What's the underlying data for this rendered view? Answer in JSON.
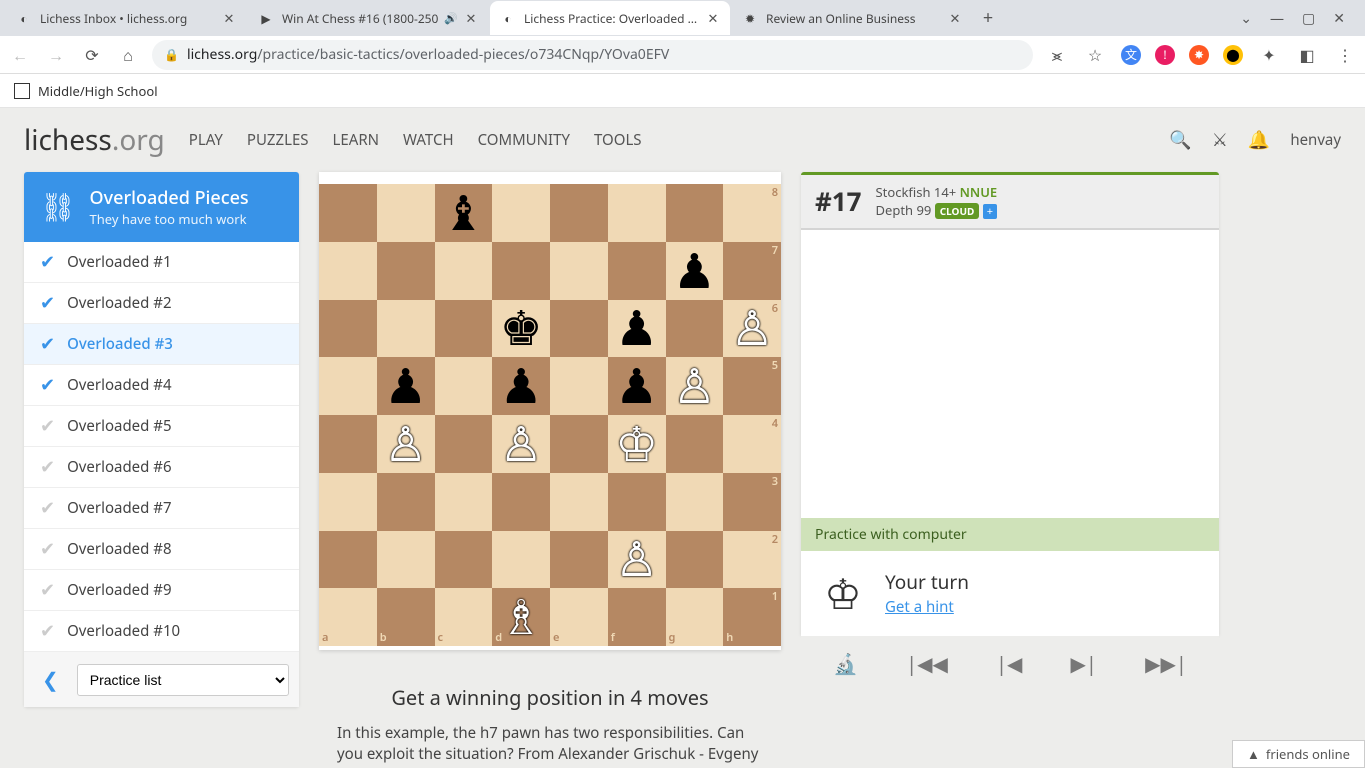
{
  "browser": {
    "tabs": [
      {
        "title": "Lichess Inbox • lichess.org",
        "favicon": "◐"
      },
      {
        "title": "Win At Chess #16 (1800-250",
        "favicon": "▶",
        "audio": true
      },
      {
        "title": "Lichess Practice: Overloaded Pie",
        "favicon": "◐",
        "active": true
      },
      {
        "title": "Review an Online Business",
        "favicon": "✹"
      }
    ],
    "url_host": "lichess.org",
    "url_path": "/practice/basic-tactics/overloaded-pieces/o734CNqp/YOva0EFV",
    "bookmark": "Middle/High School"
  },
  "nav": {
    "links": [
      "PLAY",
      "PUZZLES",
      "LEARN",
      "WATCH",
      "COMMUNITY",
      "TOOLS"
    ],
    "username": "henvay"
  },
  "practice": {
    "title": "Overloaded Pieces",
    "subtitle": "They have too much work",
    "items": [
      {
        "label": "Overloaded #1",
        "status": "done"
      },
      {
        "label": "Overloaded #2",
        "status": "done"
      },
      {
        "label": "Overloaded #3",
        "status": "done",
        "current": true
      },
      {
        "label": "Overloaded #4",
        "status": "done"
      },
      {
        "label": "Overloaded #5",
        "status": "pending"
      },
      {
        "label": "Overloaded #6",
        "status": "pending"
      },
      {
        "label": "Overloaded #7",
        "status": "pending"
      },
      {
        "label": "Overloaded #8",
        "status": "pending"
      },
      {
        "label": "Overloaded #9",
        "status": "pending"
      },
      {
        "label": "Overloaded #10",
        "status": "pending"
      }
    ],
    "selector": "Practice list"
  },
  "board": {
    "pieces": [
      {
        "sq": "c8",
        "glyph": "♝",
        "color": "black"
      },
      {
        "sq": "g7",
        "glyph": "♟",
        "color": "black"
      },
      {
        "sq": "f6",
        "glyph": "♟",
        "color": "black"
      },
      {
        "sq": "h6",
        "glyph": "♙",
        "color": "white"
      },
      {
        "sq": "d6",
        "glyph": "♚",
        "color": "black"
      },
      {
        "sq": "b5",
        "glyph": "♟",
        "color": "black"
      },
      {
        "sq": "d5",
        "glyph": "♟",
        "color": "black"
      },
      {
        "sq": "f5",
        "glyph": "♟",
        "color": "black"
      },
      {
        "sq": "g5",
        "glyph": "♙",
        "color": "white"
      },
      {
        "sq": "b4",
        "glyph": "♙",
        "color": "white"
      },
      {
        "sq": "d4",
        "glyph": "♙",
        "color": "white"
      },
      {
        "sq": "f4",
        "glyph": "♔",
        "color": "white"
      },
      {
        "sq": "f2",
        "glyph": "♙",
        "color": "white"
      },
      {
        "sq": "d1",
        "glyph": "♗",
        "color": "white"
      }
    ]
  },
  "engine": {
    "score": "#17",
    "name": "Stockfish 14+",
    "nnue": "NNUE",
    "depth_label": "Depth",
    "depth": "99",
    "cloud": "CLOUD",
    "banner": "Practice with computer",
    "turn": "Your turn",
    "hint": "Get a hint"
  },
  "goal": {
    "title": "Get a winning position in 4 moves",
    "desc": "In this example, the h7 pawn has two responsibilities. Can you exploit the situation? From Alexander Grischuk - Evgeny"
  },
  "footer": {
    "friends": "friends online"
  }
}
